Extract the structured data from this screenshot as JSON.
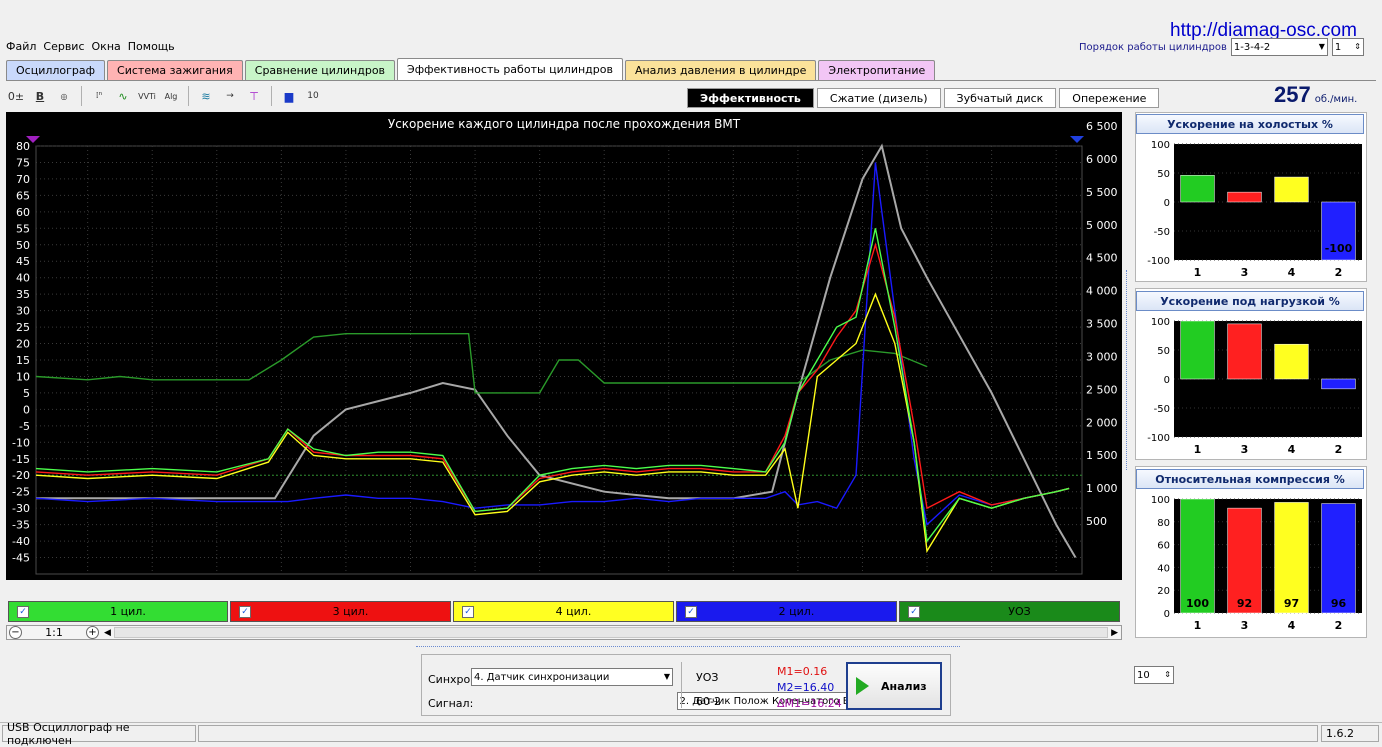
{
  "site_url": "http://diamag-osc.com",
  "menu": [
    "Файл",
    "Сервис",
    "Окна",
    "Помощь"
  ],
  "firing_order": {
    "label": "Порядок работы цилиндров",
    "value": "1-3-4-2",
    "second_value": "1"
  },
  "tabs": [
    {
      "label": "Осциллограф",
      "color": "#c9d9fb"
    },
    {
      "label": "Система зажигания",
      "color": "#ffb3b3"
    },
    {
      "label": "Сравнение цилиндров",
      "color": "#c8f5c8"
    },
    {
      "label": "Эффективность работы цилиндров",
      "color": "#ffffff",
      "active": true
    },
    {
      "label": "Анализ давления в цилиндре",
      "color": "#fbe29a"
    },
    {
      "label": "Электропитание",
      "color": "#f2c6f5"
    }
  ],
  "subtabs": [
    {
      "label": "Эффективность",
      "active": true
    },
    {
      "label": "Сжатие (дизель)"
    },
    {
      "label": "Зубчатый диск"
    },
    {
      "label": "Опережение"
    }
  ],
  "rpm": {
    "value": "257",
    "unit": "об./мин."
  },
  "chart_data": {
    "type": "line",
    "title": "Ускорение каждого цилиндра после прохождения ВМТ",
    "x_ticks": [
      "1",
      "2",
      "3",
      "4",
      "5",
      "6",
      "7",
      "8",
      "9",
      "10",
      "11",
      "12",
      "13",
      "14",
      "15",
      "16"
    ],
    "xlim": [
      0.2,
      16.4
    ],
    "y_left": {
      "range": [
        -50,
        80
      ],
      "ticks": [
        "80",
        "75",
        "70",
        "65",
        "60",
        "55",
        "50",
        "45",
        "40",
        "35",
        "30",
        "25",
        "20",
        "15",
        "10",
        "5",
        "0",
        "-5",
        "-10",
        "-15",
        "-20",
        "-25",
        "-30",
        "-35",
        "-40",
        "-45"
      ]
    },
    "y_right": {
      "range": [
        0,
        6500
      ],
      "ticks": [
        "6 500",
        "6 000",
        "5 500",
        "5 000",
        "4 500",
        "4 000",
        "3 500",
        "3 000",
        "2 500",
        "2 000",
        "1 500",
        "1 000",
        "500"
      ]
    },
    "reference_line_y": -20,
    "series": [
      {
        "name": "1 цил.",
        "color": "#4cff4c",
        "x": [
          0.2,
          1,
          2,
          3,
          3.8,
          4.1,
          4.5,
          5,
          5.5,
          6,
          6.5,
          7,
          7.5,
          8,
          8.5,
          9,
          9.5,
          10,
          10.5,
          11,
          11.5,
          11.8,
          12,
          12.3,
          12.6,
          12.9,
          13.2,
          13.5,
          13.8,
          14,
          14.5,
          15,
          15.5,
          16,
          16.2
        ],
        "y": [
          -18,
          -19,
          -18,
          -19,
          -15,
          -6,
          -12,
          -14,
          -13,
          -13,
          -14,
          -31,
          -30,
          -20,
          -18,
          -17,
          -18,
          -17,
          -17,
          -18,
          -19,
          -10,
          5,
          15,
          25,
          28,
          55,
          25,
          -10,
          -40,
          -27,
          -30,
          -27,
          -25,
          -24
        ]
      },
      {
        "name": "3 цил.",
        "color": "#ff1a1a",
        "x": [
          0.2,
          1,
          2,
          3,
          3.8,
          4.1,
          4.5,
          5,
          5.5,
          6,
          6.5,
          7,
          7.5,
          8,
          8.5,
          9,
          9.5,
          10,
          10.5,
          11,
          11.5,
          11.8,
          12,
          12.3,
          12.6,
          12.9,
          13.2,
          13.5,
          13.8,
          14,
          14.5,
          15,
          15.5,
          16,
          16.2
        ],
        "y": [
          -19,
          -20,
          -19,
          -20,
          -15,
          -6,
          -13,
          -14,
          -14,
          -14,
          -15,
          -31,
          -30,
          -21,
          -19,
          -18,
          -19,
          -18,
          -18,
          -19,
          -19,
          -8,
          5,
          12,
          22,
          30,
          50,
          28,
          -5,
          -30,
          -25,
          -29,
          -27,
          -25,
          -24
        ]
      },
      {
        "name": "4 цил.",
        "color": "#ffff1a",
        "x": [
          0.2,
          1,
          2,
          3,
          3.8,
          4.1,
          4.5,
          5,
          5.5,
          6,
          6.5,
          7,
          7.5,
          8,
          8.5,
          9,
          9.5,
          10,
          10.5,
          11,
          11.5,
          11.8,
          12,
          12.3,
          12.6,
          12.9,
          13.2,
          13.5,
          13.8,
          14,
          14.5,
          15,
          15.5,
          16,
          16.2
        ],
        "y": [
          -20,
          -21,
          -20,
          -21,
          -16,
          -7,
          -14,
          -15,
          -15,
          -15,
          -16,
          -32,
          -31,
          -22,
          -20,
          -19,
          -20,
          -19,
          -19,
          -20,
          -20,
          -12,
          -30,
          10,
          15,
          20,
          35,
          20,
          -10,
          -43,
          -27,
          -30,
          -27,
          -25,
          -24
        ]
      },
      {
        "name": "2 цил.",
        "color": "#1a1aff",
        "x": [
          0.2,
          1,
          2,
          3,
          3.8,
          4.1,
          4.5,
          5,
          5.5,
          6,
          6.5,
          7,
          7.5,
          8,
          8.5,
          9,
          9.5,
          10,
          10.5,
          11,
          11.5,
          11.8,
          12,
          12.3,
          12.6,
          12.9,
          13.2,
          13.5,
          13.8,
          14,
          14.5,
          15,
          15.5,
          16,
          16.2
        ],
        "y": [
          -27,
          -28,
          -27,
          -28,
          -28,
          -28,
          -27,
          -26,
          -27,
          -27,
          -28,
          -30,
          -29,
          -29,
          -28,
          -28,
          -27,
          -28,
          -27,
          -27,
          -27,
          -25,
          -29,
          -28,
          -30,
          -20,
          75,
          30,
          -15,
          -35,
          -26,
          -29,
          -27,
          -25,
          -24
        ]
      },
      {
        "name": "УОЗ",
        "color": "#2a9a2a",
        "x": [
          0.2,
          1,
          1.5,
          2,
          3,
          3.5,
          4,
          4.5,
          5,
          6,
          6.9,
          7,
          7.5,
          8,
          8.3,
          8.6,
          9,
          9.5,
          10,
          11,
          11.5,
          12,
          12.5,
          13,
          13.5,
          14
        ],
        "y": [
          10,
          9,
          10,
          9,
          9,
          9,
          15,
          22,
          23,
          23,
          23,
          5,
          5,
          5,
          15,
          15,
          8,
          8,
          8,
          8,
          8,
          8,
          15,
          18,
          17,
          13
        ]
      },
      {
        "name": "RPM",
        "color": "#a8a8a8",
        "x": [
          0.2,
          1,
          2,
          3,
          3.9,
          4.5,
          5,
          6,
          6.5,
          7,
          7.5,
          8,
          9,
          10,
          11,
          11.6,
          12,
          12.5,
          13,
          13.3,
          13.6,
          14,
          15,
          16,
          16.3
        ],
        "y": [
          -27,
          -27,
          -27,
          -27,
          -27,
          -8,
          0,
          5,
          8,
          6,
          -8,
          -20,
          -25,
          -27,
          -27,
          -25,
          5,
          40,
          70,
          80,
          55,
          40,
          5,
          -35,
          -45
        ]
      }
    ],
    "legend_checked": [
      true,
      true,
      true,
      true,
      true
    ]
  },
  "legend_labels": [
    "1 цил.",
    "3 цил.",
    "4 цил.",
    "2 цил.",
    "УОЗ"
  ],
  "zoom_label": "1:1",
  "side_panels": [
    {
      "title": "Ускорение на холостых %",
      "categories": [
        "1",
        "3",
        "4",
        "2"
      ],
      "values": [
        46,
        17,
        43,
        -100
      ],
      "colors": [
        "#22cc22",
        "#ff2020",
        "#ffff20",
        "#2020ff"
      ],
      "ylim": [
        -100,
        100
      ],
      "y_ticks": [
        "100",
        "50",
        "0",
        "-50",
        "-100"
      ],
      "value_labels": [
        "",
        "",
        "",
        "-100"
      ]
    },
    {
      "title": "Ускорение под нагрузкой %",
      "categories": [
        "1",
        "3",
        "4",
        "2"
      ],
      "values": [
        100,
        95,
        60,
        -17
      ],
      "colors": [
        "#22cc22",
        "#ff2020",
        "#ffff20",
        "#2020ff"
      ],
      "ylim": [
        -100,
        100
      ],
      "y_ticks": [
        "100",
        "50",
        "0",
        "-50",
        "-100"
      ],
      "value_labels": [
        "",
        "",
        "",
        ""
      ]
    },
    {
      "title": "Относительная компрессия %",
      "categories": [
        "1",
        "3",
        "4",
        "2"
      ],
      "values": [
        100,
        92,
        97,
        96
      ],
      "colors": [
        "#22cc22",
        "#ff2020",
        "#ffff20",
        "#2020ff"
      ],
      "ylim": [
        0,
        100
      ],
      "y_ticks": [
        "100",
        "80",
        "60",
        "40",
        "20",
        "0"
      ],
      "value_labels": [
        "100",
        "92",
        "97",
        "96"
      ]
    }
  ],
  "controls": {
    "sync_label": "Синхро:",
    "sync_value": "4.  Датчик синхронизации",
    "signal_label": "Сигнал:",
    "signal_value": "2.  Датчик Полож Коленчатого Вал",
    "uoz_label": "УОЗ",
    "uoz_value": "10",
    "teeth": "60-2",
    "m1": "M1=0.16",
    "m2": "M2=16.40",
    "dm1": "ΔM1=16.24",
    "analyze": "Анализ"
  },
  "status": {
    "left": "USB Осциллограф не подключен",
    "version": "1.6.2"
  }
}
